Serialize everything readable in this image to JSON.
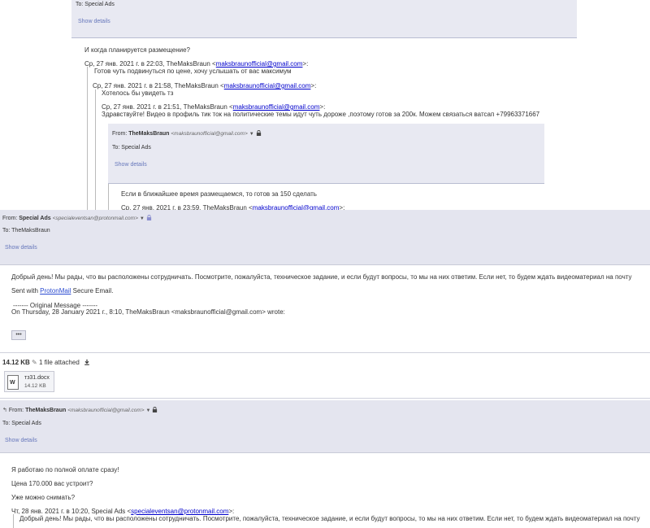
{
  "top_panel": {
    "to_line": "To: Special Ads",
    "show_details": "Show details",
    "question": "И когда планируется размещение?",
    "q1_head": "Ср, 27 янв. 2021 г. в 22:03, TheMaksBraun <",
    "q1_email": "maksbraunofficial@gmail.com",
    "q1_tail": ">:",
    "q1_text": "Готов чуть подвинуться по цене, хочу услышать от вас максимум",
    "q2_head": "Ср, 27 янв. 2021 г. в 21:58, TheMaksBraun <",
    "q2_email": "maksbraunofficial@gmail.com",
    "q2_tail": ">:",
    "q2_text": "Хотелось бы увидеть тз",
    "q3_head": "Ср, 27 янв. 2021 г. в 21:51, TheMaksBraun <",
    "q3_email": "maksbraunofficial@gmail.com",
    "q3_tail": ">:",
    "q3_text": "Здравствуйте! Видео в профиль тик ток на политические темы идут чуть дороже ,поэтому готов за 200к. Можем связаться ватсап +79963371667",
    "inner_from_label": "From:",
    "inner_from_name": "TheMaksBraun",
    "inner_from_email": "<maksbraunofficial@gmail.com>",
    "inner_to": "To: Special Ads",
    "inner_show_details": "Show details",
    "inner_text": "Если в ближайшее время размещаемся, то готов за 150 сделать",
    "q4_head": "Ср, 27 янв. 2021 г. в 23:59, TheMaksBraun <",
    "q4_email": "maksbraunofficial@gmail.com",
    "q4_tail": ">:"
  },
  "middle_panel": {
    "from_label": "From:",
    "from_name": "Special Ads",
    "from_email": "<specialeventsan@protonmail.com>",
    "to_line": "To: TheMaksBraun",
    "show_details": "Show details",
    "body_text": "Добрый день! Мы рады, что вы расположены сотрудничать. Посмотрите, пожалуйста, техническое задание, и если будут вопросы, то мы на них ответим. Если нет, то будем ждать видеоматериал на почту",
    "sent_with_prefix": "Sent with ",
    "sent_with_link": "ProtonMail",
    "sent_with_suffix": " Secure Email.",
    "orig_msg": "------- Original Message -------",
    "orig_line": "On Thursday, 28 January 2021 г., 8:10, TheMaksBraun <maksbraunofficial@gmail.com> wrote:",
    "dots_button": "•••"
  },
  "attachments": {
    "size": "14.12 KB",
    "count": "1 file attached",
    "file_name": "тз31.docx",
    "file_size": "14.12 KB"
  },
  "bottom_panel": {
    "from_label": "From:",
    "from_name": "TheMaksBraun",
    "from_email": "<maksbraunofficial@gmail.com>",
    "to_line": "To: Special Ads",
    "show_details": "Show details",
    "line1": "Я работаю по полной оплате сразу!",
    "line2": "Цена 170.000 вас устроит?",
    "line3": "Уже можно снимать?",
    "q_head": "Чт, 28 янв. 2021 г. в 10:20, Special Ads <",
    "q_email": "specialeventsan@protonmail.com",
    "q_tail": ">:",
    "q_text": "Добрый день! Мы рады, что вы расположены сотрудничать. Посмотрите, пожалуйста, техническое задание, и если будут вопросы, то мы на них ответим. Если нет, то будем ждать видеоматериал на почту"
  }
}
